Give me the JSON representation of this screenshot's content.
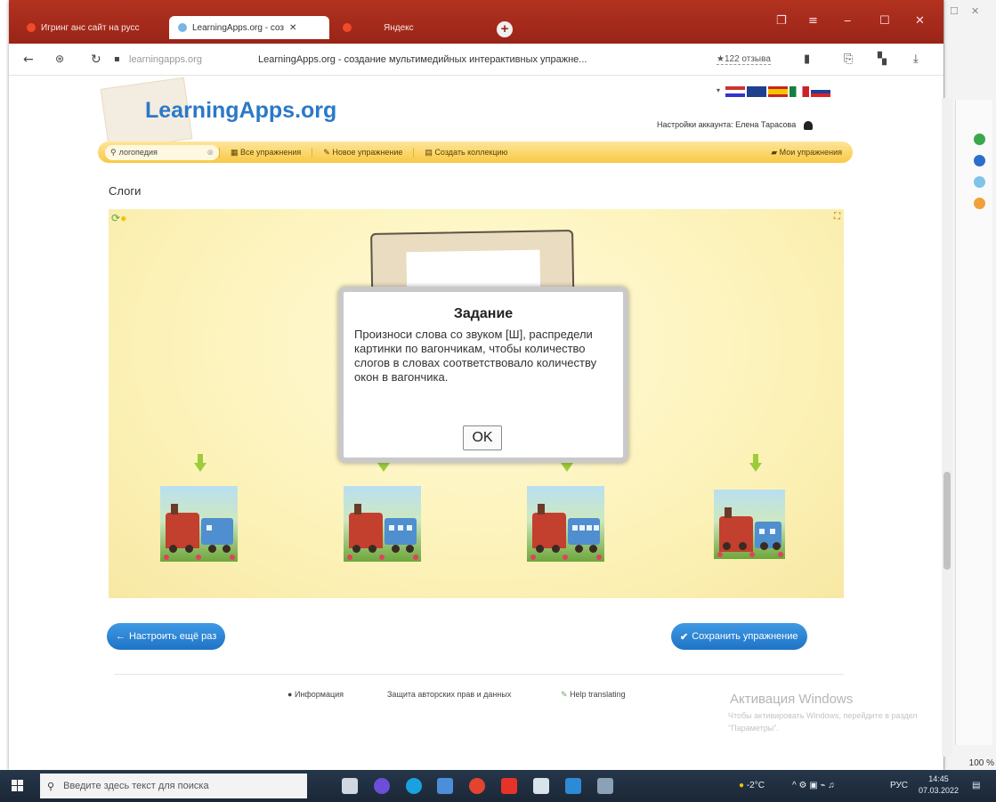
{
  "browser": {
    "tabs": [
      {
        "label": "Игринг анс сайт на русс"
      },
      {
        "label": "LearningApps.org - соз"
      },
      {
        "label": "Яндекс"
      }
    ],
    "url": "learningapps.org",
    "page_title": "LearningApps.org - создание мультимедийных интерактивных упражне...",
    "reviews": "★122 отзыва"
  },
  "site": {
    "logo": "LearningApps.org",
    "account": "Настройки аккаунта: Елена Тарасова",
    "search_value": "логопедия",
    "menu": {
      "all": "Все упражнения",
      "new": "Новое упражнение",
      "collection": "Создать коллекцию",
      "mine": "Мои упражнения"
    }
  },
  "exercise": {
    "title": "Слоги",
    "dialog_title": "Задание",
    "dialog_text": "Произноси слова со звуком [Ш], распредели картинки по вагончикам, чтобы количество слогов в словах соответствовало количеству окон в вагончика.",
    "ok_label": "OK"
  },
  "actions": {
    "back": "Настроить ещё раз",
    "save": "Сохранить упражнение"
  },
  "footer": {
    "info": "Информация",
    "privacy": "Защита авторских прав и данных",
    "help": "Help translating"
  },
  "watermark": {
    "title": "Активация Windows",
    "text": "Чтобы активировать Windows, перейдите в раздел \"Параметры\"."
  },
  "zoom": "100 %",
  "taskbar": {
    "search_placeholder": "Введите здесь текст для поиска",
    "weather": "-2°C",
    "lang": "РУС",
    "time": "14:45",
    "date": "07.03.2022"
  },
  "colors": {
    "tabbar": "#a52a1e",
    "logo_blue": "#2b79c7",
    "menubar": "#f7c944",
    "stage_bg": "#fdf4c2",
    "button_blue": "#1e73c6"
  }
}
